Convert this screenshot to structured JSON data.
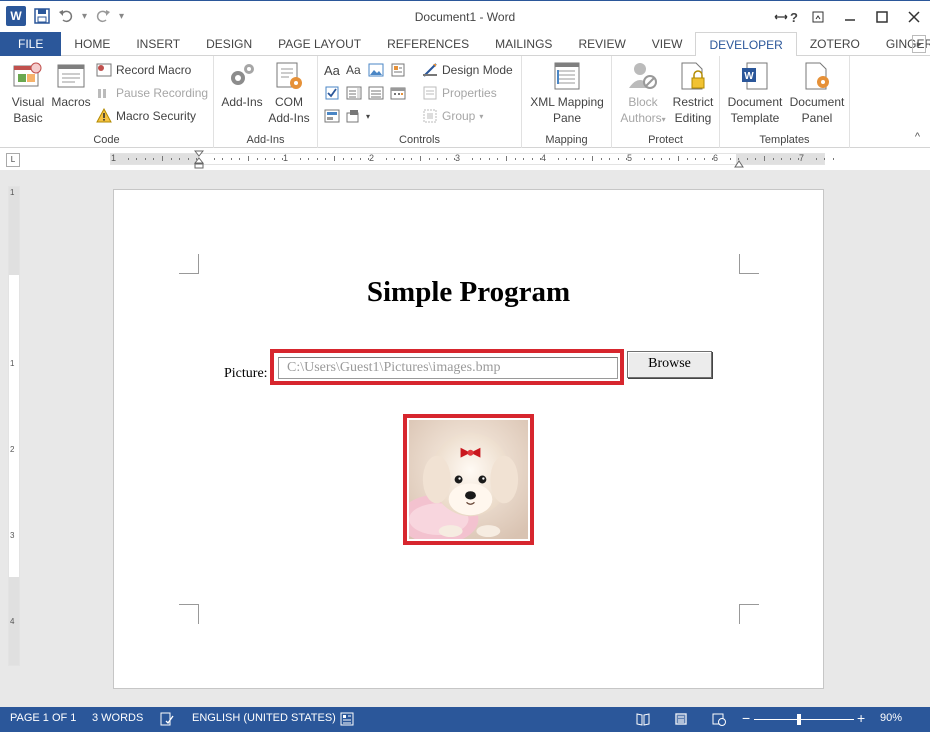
{
  "window": {
    "title": "Document1 - Word",
    "word_logo": "W",
    "help": "?",
    "controls": [
      "restore-icon",
      "minimize-icon",
      "maximize-icon",
      "close-icon"
    ]
  },
  "tabs": [
    {
      "label": "FILE",
      "state": "file"
    },
    {
      "label": "HOME"
    },
    {
      "label": "INSERT"
    },
    {
      "label": "DESIGN"
    },
    {
      "label": "PAGE LAYOUT"
    },
    {
      "label": "REFERENCES"
    },
    {
      "label": "MAILINGS"
    },
    {
      "label": "REVIEW"
    },
    {
      "label": "VIEW"
    },
    {
      "label": "DEVELOPER",
      "state": "active"
    },
    {
      "label": "ZOTERO"
    },
    {
      "label": "GINGER"
    }
  ],
  "ribbon": {
    "code": {
      "label": "Code",
      "visual_basic": "Visual\nBasic",
      "visual_basic_l1": "Visual",
      "visual_basic_l2": "Basic",
      "macros": "Macros",
      "record_macro": "Record Macro",
      "pause_recording": "Pause Recording",
      "macro_security": "Macro Security"
    },
    "addins": {
      "label": "Add-Ins",
      "addins_btn": "Add-Ins",
      "com_l1": "COM",
      "com_l2": "Add-Ins"
    },
    "controls": {
      "label": "Controls",
      "design_mode": "Design Mode",
      "properties": "Properties",
      "group": "Group",
      "aa1": "Aa",
      "aa2": "Aa"
    },
    "mapping": {
      "label": "Mapping",
      "xml_l1": "XML Mapping",
      "xml_l2": "Pane"
    },
    "protect": {
      "label": "Protect",
      "block_l1": "Block",
      "block_l2": "Authors",
      "restrict_l1": "Restrict",
      "restrict_l2": "Editing"
    },
    "templates": {
      "label": "Templates",
      "doct_l1": "Document",
      "doct_l2": "Template",
      "docp_l1": "Document",
      "docp_l2": "Panel"
    }
  },
  "ruler": {
    "h_numbers": [
      "1",
      "1",
      "2",
      "3",
      "4",
      "5",
      "6",
      "7"
    ],
    "v_numbers": [
      "1",
      "1",
      "2",
      "3",
      "4"
    ]
  },
  "document": {
    "title": "Simple Program",
    "picture_label": "Picture:",
    "path_value": "C:\\Users\\Guest1\\Pictures\\images.bmp",
    "browse_label": "Browse",
    "highlight_color": "#d7262e"
  },
  "status": {
    "page": "PAGE 1 OF 1",
    "words": "3 WORDS",
    "language": "ENGLISH (UNITED STATES)",
    "zoom": "90%",
    "zoom_minus": "−",
    "zoom_plus": "+",
    "zoom_level": 0.45
  },
  "colors": {
    "accent": "#2b579a",
    "highlight": "#d7262e"
  }
}
